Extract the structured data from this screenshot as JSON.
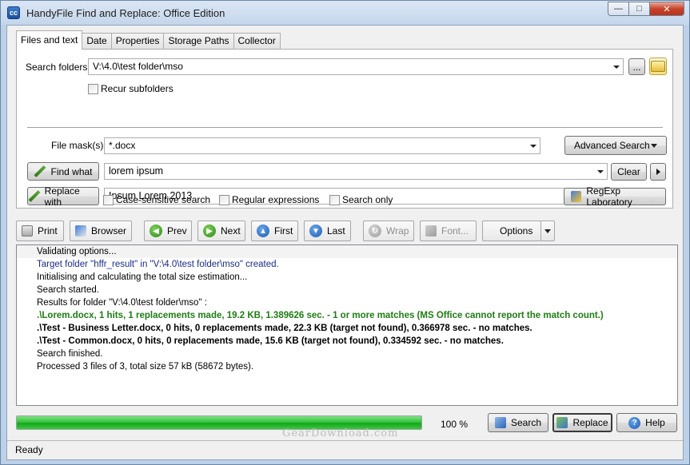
{
  "window": {
    "title": "HandyFile Find and Replace: Office Edition",
    "app_icon_text": "cc"
  },
  "tabs": [
    "Files and text",
    "Date",
    "Properties",
    "Storage Paths",
    "Collector"
  ],
  "form": {
    "search_folders_label": "Search folders:",
    "search_folders_value": "V:\\4.0\\test folder\\mso",
    "browse_label": "...",
    "recur_subfolders_label": "Recur subfolders",
    "file_mask_label": "File mask(s):",
    "file_mask_value": "*.docx",
    "advanced_search_label": "Advanced Search",
    "find_what_label": "Find what",
    "find_what_value": "lorem ipsum",
    "replace_with_label": "Replace with",
    "replace_with_value": "Ipsum Lorem 2013",
    "clear_label": "Clear",
    "case_sensitive_label": "Case-sensitive search",
    "regex_label": "Regular expressions",
    "search_only_label": "Search only",
    "regexp_lab_label": "RegExp Laboratory"
  },
  "toolbar": {
    "print": "Print",
    "browser": "Browser",
    "prev": "Prev",
    "next": "Next",
    "first": "First",
    "last": "Last",
    "wrap": "Wrap",
    "font": "Font...",
    "options": "Options"
  },
  "log": [
    {
      "text": "Validating options...",
      "style": "first"
    },
    {
      "text": "Target folder \"hffr_result\" in \"V:\\4.0\\test folder\\mso\" created.",
      "style": "blue"
    },
    {
      "text": "Initialising and calculating the total size estimation...",
      "style": "normal"
    },
    {
      "text": "Search started.",
      "style": "normal"
    },
    {
      "text": "Results for folder \"V:\\4.0\\test folder\\mso\" :",
      "style": "normal"
    },
    {
      "text": ".\\Lorem.docx, 1 hits, 1 replacements made, 19.2 KB, 1.389626 sec. - 1 or more matches (MS Office cannot report the match count.)",
      "style": "green"
    },
    {
      "text": ".\\Test - Business Letter.docx, 0 hits, 0 replacements made, 22.3 KB (target not found), 0.366978 sec. - no matches.",
      "style": "bold"
    },
    {
      "text": ".\\Test - Common.docx, 0 hits, 0 replacements made, 15.6 KB (target not found), 0.334592 sec. - no matches.",
      "style": "bold"
    },
    {
      "text": "Search finished.",
      "style": "normal"
    },
    {
      "text": "Processed 3 files of 3, total size 57 kB (58672 bytes).",
      "style": "normal"
    }
  ],
  "progress": {
    "percent_value": 1.0,
    "percent_label": "100 %"
  },
  "actions": {
    "search": "Search",
    "replace": "Replace",
    "help": "Help"
  },
  "status": {
    "text": "Ready"
  },
  "watermark": "GearDownload.com"
}
